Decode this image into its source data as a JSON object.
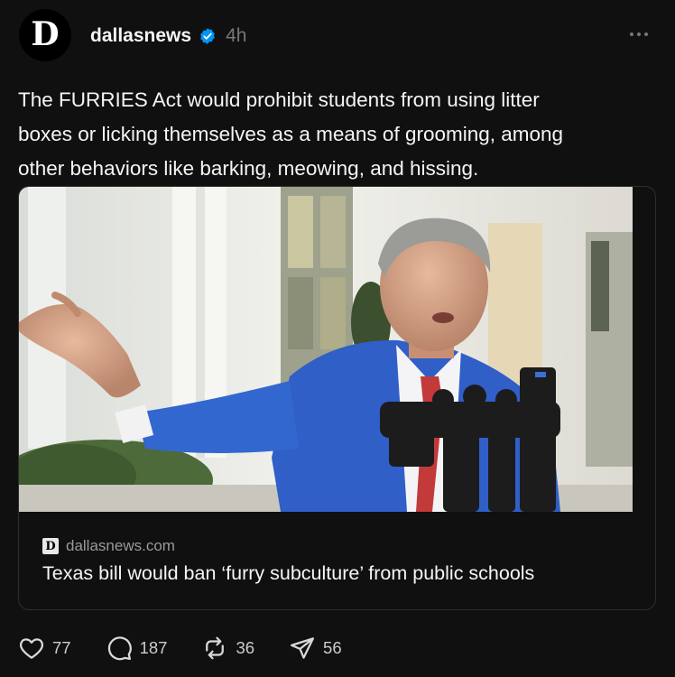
{
  "post": {
    "avatar_letter": "D",
    "username": "dallasnews",
    "verified": true,
    "time": "4h",
    "text": "The FURRIES Act would prohibit students from using litter\nboxes or licking themselves as a means of grooming, among\nother behaviors like barking, meowing, and hissing."
  },
  "card": {
    "source_logo": "D",
    "domain": "dallasnews.com",
    "title": "Texas bill would ban ‘furry subculture’ from public schools"
  },
  "actions": {
    "likes": "77",
    "replies": "187",
    "reposts": "36",
    "shares": "56"
  },
  "colors": {
    "background": "#101010",
    "verified": "#0095f6",
    "suit": "#2f5fc7"
  },
  "icons": [
    "more-icon",
    "verified-badge-icon",
    "heart-icon",
    "comment-icon",
    "repost-icon",
    "share-icon"
  ]
}
